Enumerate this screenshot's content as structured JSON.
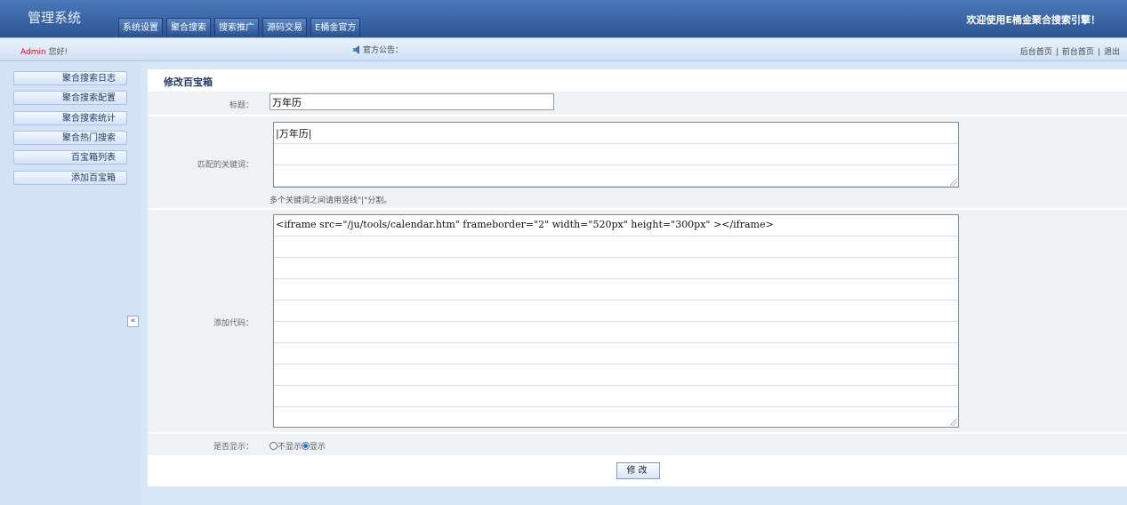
{
  "header": {
    "logo": "管理系统",
    "nav": [
      "系统设置",
      "聚合搜索",
      "搜索推广",
      "源码交易",
      "E桶金官方"
    ],
    "welcome": "欢迎使用E桶金聚合搜索引擎！"
  },
  "infobar": {
    "user_name": "Admin",
    "greeting": " 您好!",
    "notice_label": "官方公告：",
    "links": [
      "后台首页",
      "前台首页",
      "退出"
    ]
  },
  "sidebar": {
    "items": [
      "聚合搜索日志",
      "聚合搜索配置",
      "聚合搜索统计",
      "聚合热门搜索",
      "百宝箱列表",
      "添加百宝箱"
    ],
    "collapse_label": "«"
  },
  "form": {
    "title": "修改百宝箱",
    "fields": {
      "name_label": "标题：",
      "name_value": "万年历",
      "keywords_label": "匹配的关键词：",
      "keywords_value": "|万年历|",
      "keywords_hint": "多个关键词之间请用竖线\"|\"分割。",
      "code_label": "添加代码：",
      "code_value": "<iframe src=\"/ju/tools/calendar.htm\" frameborder=\"2\" width=\"520px\" height=\"300px\" ></iframe>",
      "display_label": "是否显示：",
      "display_options": [
        "不显示",
        "显示"
      ],
      "display_selected": "显示"
    },
    "submit_label": "修改"
  },
  "colors": {
    "header": "#2c5592",
    "background": "#d9e6f5",
    "row": "#eff2f5"
  }
}
